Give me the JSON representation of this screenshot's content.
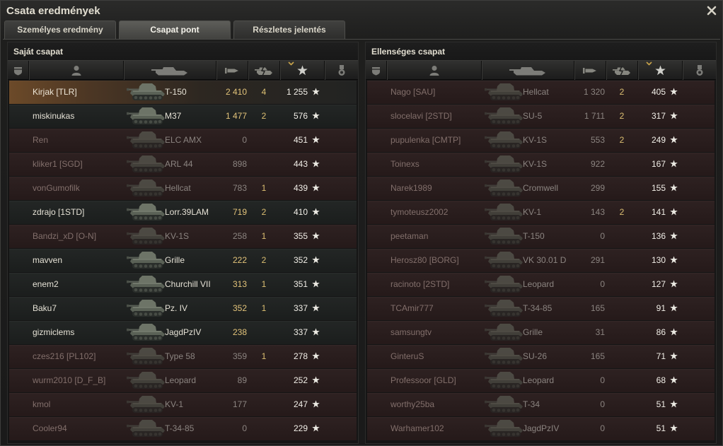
{
  "window": {
    "title": "Csata eredmények"
  },
  "tabs": [
    {
      "label": "Személyes eredmény",
      "active": false
    },
    {
      "label": "Csapat pont",
      "active": true
    },
    {
      "label": "Részletes jelentés",
      "active": false
    }
  ],
  "table_header": {
    "columns": [
      {
        "icon": "platoon-icon"
      },
      {
        "icon": "player-icon"
      },
      {
        "icon": "vehicle-icon"
      },
      {
        "icon": "damage-icon"
      },
      {
        "icon": "kills-icon"
      },
      {
        "icon": "xp-star-icon"
      },
      {
        "icon": "medal-icon"
      }
    ],
    "sorted_column": "xp-star-icon",
    "sort_indicator_icon": "chevron-down-icon"
  },
  "teams": [
    {
      "title": "Saját csapat",
      "players": [
        {
          "name": "Kirjak [TLR]",
          "vehicle": "T-150",
          "damage": "2 410",
          "kills": "4",
          "xp": "1 255",
          "destroyed": false,
          "current_player": true
        },
        {
          "name": "miskinukas",
          "vehicle": "M37",
          "damage": "1 477",
          "kills": "2",
          "xp": "576",
          "destroyed": false
        },
        {
          "name": "Ren",
          "vehicle": "ELC AMX",
          "damage": "0",
          "kills": "",
          "xp": "451",
          "destroyed": true
        },
        {
          "name": "kliker1 [SGD]",
          "vehicle": "ARL 44",
          "damage": "898",
          "kills": "",
          "xp": "443",
          "destroyed": true
        },
        {
          "name": "vonGumofilk",
          "vehicle": "Hellcat",
          "damage": "783",
          "kills": "1",
          "xp": "439",
          "destroyed": true
        },
        {
          "name": "zdrajo [1STD]",
          "vehicle": "Lorr.39LAM",
          "damage": "719",
          "kills": "2",
          "xp": "410",
          "destroyed": false
        },
        {
          "name": "Bandzi_xD [O-N]",
          "vehicle": "KV-1S",
          "damage": "258",
          "kills": "1",
          "xp": "355",
          "destroyed": true
        },
        {
          "name": "mavven",
          "vehicle": "Grille",
          "damage": "222",
          "kills": "2",
          "xp": "352",
          "destroyed": false
        },
        {
          "name": "enem2",
          "vehicle": "Churchill VII",
          "damage": "313",
          "kills": "1",
          "xp": "351",
          "destroyed": false
        },
        {
          "name": "Baku7",
          "vehicle": "Pz. IV",
          "damage": "352",
          "kills": "1",
          "xp": "337",
          "destroyed": false
        },
        {
          "name": "gizmiclems",
          "vehicle": "JagdPzIV",
          "damage": "238",
          "kills": "",
          "xp": "337",
          "destroyed": false
        },
        {
          "name": "czes216 [PL102]",
          "vehicle": "Type 58",
          "damage": "359",
          "kills": "1",
          "xp": "278",
          "destroyed": true
        },
        {
          "name": "wurm2010 [D_F_B]",
          "vehicle": "Leopard",
          "damage": "89",
          "kills": "",
          "xp": "252",
          "destroyed": true
        },
        {
          "name": "kmol",
          "vehicle": "KV-1",
          "damage": "177",
          "kills": "",
          "xp": "247",
          "destroyed": true
        },
        {
          "name": "Cooler94",
          "vehicle": "T-34-85",
          "damage": "0",
          "kills": "",
          "xp": "229",
          "destroyed": true
        }
      ]
    },
    {
      "title": "Ellenséges csapat",
      "players": [
        {
          "name": "Nago [SAU]",
          "vehicle": "Hellcat",
          "damage": "1 320",
          "kills": "2",
          "xp": "405",
          "destroyed": true
        },
        {
          "name": "slocelavi [2STD]",
          "vehicle": "SU-5",
          "damage": "1 711",
          "kills": "2",
          "xp": "317",
          "destroyed": true
        },
        {
          "name": "pupulenka [CMTP]",
          "vehicle": "KV-1S",
          "damage": "553",
          "kills": "2",
          "xp": "249",
          "destroyed": true
        },
        {
          "name": "Toinexs",
          "vehicle": "KV-1S",
          "damage": "922",
          "kills": "",
          "xp": "167",
          "destroyed": true
        },
        {
          "name": "Narek1989",
          "vehicle": "Cromwell",
          "damage": "299",
          "kills": "",
          "xp": "155",
          "destroyed": true
        },
        {
          "name": "tymoteusz2002",
          "vehicle": "KV-1",
          "damage": "143",
          "kills": "2",
          "xp": "141",
          "destroyed": true
        },
        {
          "name": "peetaman",
          "vehicle": "T-150",
          "damage": "0",
          "kills": "",
          "xp": "136",
          "destroyed": true
        },
        {
          "name": "Herosz80 [BORG]",
          "vehicle": "VK 30.01 D",
          "damage": "291",
          "kills": "",
          "xp": "130",
          "destroyed": true
        },
        {
          "name": "racinoto [2STD]",
          "vehicle": "Leopard",
          "damage": "0",
          "kills": "",
          "xp": "127",
          "destroyed": true
        },
        {
          "name": "TCAmir777",
          "vehicle": "T-34-85",
          "damage": "165",
          "kills": "",
          "xp": "91",
          "destroyed": true
        },
        {
          "name": "samsungtv",
          "vehicle": "Grille",
          "damage": "31",
          "kills": "",
          "xp": "86",
          "destroyed": true
        },
        {
          "name": "GinteruS",
          "vehicle": "SU-26",
          "damage": "165",
          "kills": "",
          "xp": "71",
          "destroyed": true
        },
        {
          "name": "Professoor [GLD]",
          "vehicle": "Leopard",
          "damage": "0",
          "kills": "",
          "xp": "68",
          "destroyed": true
        },
        {
          "name": "worthy25ba",
          "vehicle": "T-34",
          "damage": "0",
          "kills": "",
          "xp": "51",
          "destroyed": true
        },
        {
          "name": "Warhamer102",
          "vehicle": "JagdPzIV",
          "damage": "0",
          "kills": "",
          "xp": "51",
          "destroyed": true
        }
      ]
    }
  ],
  "colors": {
    "alive_row": "#1e2120",
    "destroyed_row": "#2a1d1d",
    "current_player_row": "#6c4a29",
    "alive_text": "#e5e1d5",
    "destroyed_name": "#826f6b",
    "destroyed_text": "#8b8480",
    "damage": "#e2c37a",
    "kills": "#dcbf72",
    "xp": "#f1eee7",
    "sort_arrow": "#c9a44a"
  }
}
